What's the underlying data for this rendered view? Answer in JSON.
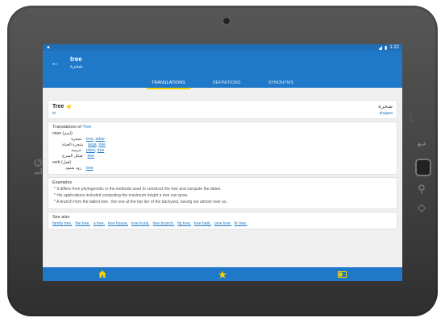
{
  "device": {
    "brand": "LG"
  },
  "statusbar": {
    "time": "1:22"
  },
  "appbar": {
    "word": "tree",
    "translation": "شجرة"
  },
  "tabs": [
    "TRANSLATIONS",
    "DEFINITIONS",
    "SYNONYMS"
  ],
  "headword": {
    "word": "Tree",
    "phonetic": "tri",
    "arabic": "شجرة",
    "transliteration": "shajara"
  },
  "translations": {
    "title_prefix": "Translations of",
    "title_word": "Tree",
    "noun_label": "noun (اسم)",
    "noun_rows": [
      {
        "ar": "شجرة",
        "links": [
          "tree",
          "arbor"
        ]
      },
      {
        "ar": "شجرة الحياة",
        "links": [
          "lauja",
          "tree"
        ]
      },
      {
        "ar": "خرسة",
        "links": [
          "plant",
          "tree"
        ]
      },
      {
        "ar": "هيكل السرج",
        "links": [
          "tree"
        ]
      }
    ],
    "verb_label": "verb (فعل)",
    "verb_rows": [
      {
        "ar": "زود بعمود",
        "links": [
          "tree"
        ]
      }
    ]
  },
  "examples": {
    "title": "Examples",
    "items": [
      "It differs from phylogenetic in the methods used to construct the tree and compute the dates.",
      "His applications included computing the maximum height a tree can grow.",
      "A branch from the tallest tree , the one at the top tier of the backyard, swung out almost over us."
    ]
  },
  "see_also": {
    "title": "See also",
    "items": [
      "family tree",
      "the tree",
      "a tree",
      "tree house",
      "tree trunk",
      "tree branch",
      "fig tree",
      "tree bark",
      "pine tree",
      "fir tree"
    ]
  },
  "colors": {
    "primary": "#1f78c8",
    "accent": "#f7d300"
  },
  "icons": {
    "back": "arrow-left-icon",
    "home": "home-icon",
    "star": "star-icon",
    "flashcards": "flashcards-icon"
  }
}
